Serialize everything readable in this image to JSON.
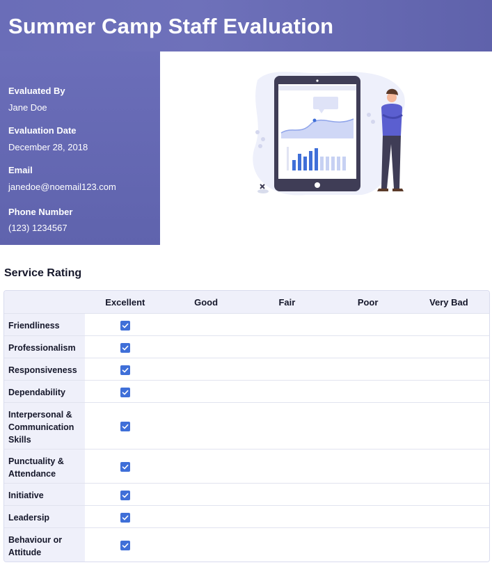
{
  "header": {
    "title": "Summer Camp Staff Evaluation"
  },
  "info": {
    "evaluated_by_label": "Evaluated By",
    "evaluated_by_value": "Jane Doe",
    "date_label": "Evaluation Date",
    "date_value": "December 28, 2018",
    "email_label": "Email",
    "email_value": "janedoe@noemail123.com",
    "phone_label": "Phone Number",
    "phone_value": "(123) 1234567"
  },
  "colors": {
    "header_bg": "#6a6db8",
    "check": "#3f6fd8",
    "table_header_bg": "#eff0fa"
  },
  "service_rating": {
    "title": "Service Rating",
    "columns": [
      "Excellent",
      "Good",
      "Fair",
      "Poor",
      "Very Bad"
    ],
    "rows": [
      {
        "label": "Friendliness",
        "selected": "Excellent"
      },
      {
        "label": "Professionalism",
        "selected": "Excellent"
      },
      {
        "label": "Responsiveness",
        "selected": "Excellent"
      },
      {
        "label": "Dependability",
        "selected": "Excellent"
      },
      {
        "label": "Interpersonal & Communication Skills",
        "selected": "Excellent"
      },
      {
        "label": "Punctuality & Attendance",
        "selected": "Excellent"
      },
      {
        "label": "Initiative",
        "selected": "Excellent"
      },
      {
        "label": "Leadersip",
        "selected": "Excellent"
      },
      {
        "label": "Behaviour or Attitude",
        "selected": "Excellent"
      }
    ]
  }
}
